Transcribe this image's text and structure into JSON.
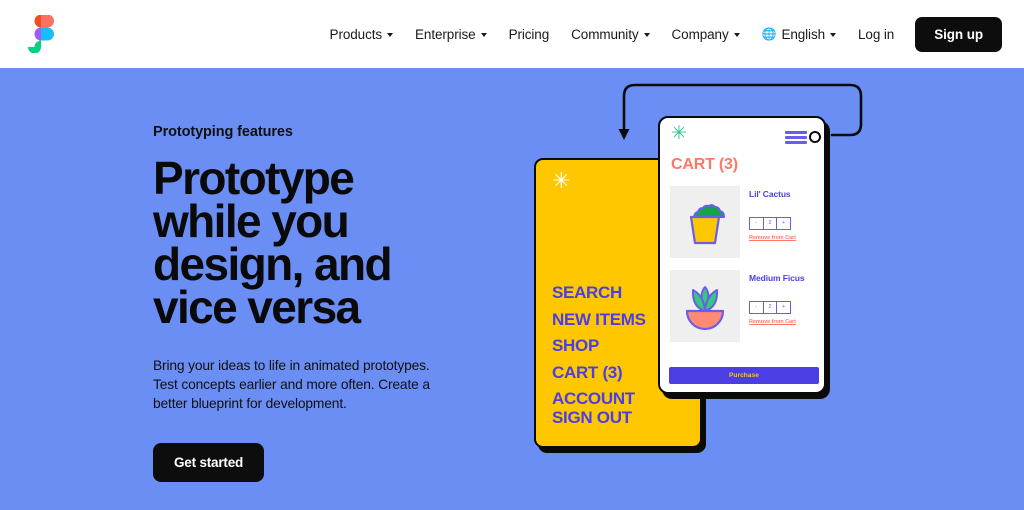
{
  "colors": {
    "hero_bg": "#6B8EF5",
    "yellow_card": "#FFC700",
    "accent_purple": "#4B3FE4",
    "coral": "#FF7866",
    "green": "#2FC48D",
    "black": "#0D0D0D"
  },
  "navbar": {
    "logo": "figma-logo",
    "items": [
      {
        "label": "Products",
        "has_caret": true
      },
      {
        "label": "Enterprise",
        "has_caret": true
      },
      {
        "label": "Pricing",
        "has_caret": false
      },
      {
        "label": "Community",
        "has_caret": true
      },
      {
        "label": "Company",
        "has_caret": true
      }
    ],
    "language": {
      "icon": "globe-icon",
      "glyph": "🌐",
      "label": "English",
      "has_caret": true
    },
    "login_label": "Log in",
    "signup_label": "Sign up"
  },
  "hero": {
    "eyebrow": "Prototyping features",
    "headline": "Prototype while you design, and vice versa",
    "subtext": "Bring your ideas to life in animated prototypes. Test concepts earlier and more often. Create a better blueprint for development.",
    "cta_label": "Get started"
  },
  "illustration": {
    "menu_card": {
      "spark_glyph": "✳",
      "links": [
        "SEARCH",
        "NEW ITEMS",
        "SHOP",
        "CART (3)",
        "ACCOUNT"
      ],
      "signout_label": "SIGN OUT"
    },
    "phone_card": {
      "spark_glyph": "✳",
      "menu_icon": "hamburger-icon",
      "node_handle": "prototype-node-handle",
      "cart_title": "CART (3)",
      "items": [
        {
          "name": "Lil' Cactus",
          "thumb": "cactus-in-yellow-pot",
          "quantity": "2",
          "minus_label": "-",
          "plus_label": "+",
          "remove_label": "Remove from Cart"
        },
        {
          "name": "Medium Ficus",
          "thumb": "ficus-in-coral-pot",
          "quantity": "2",
          "minus_label": "-",
          "plus_label": "+",
          "remove_label": "Remove from Cart"
        }
      ],
      "purchase_label": "Purchase"
    },
    "connector": "prototype-flow-arrow"
  }
}
